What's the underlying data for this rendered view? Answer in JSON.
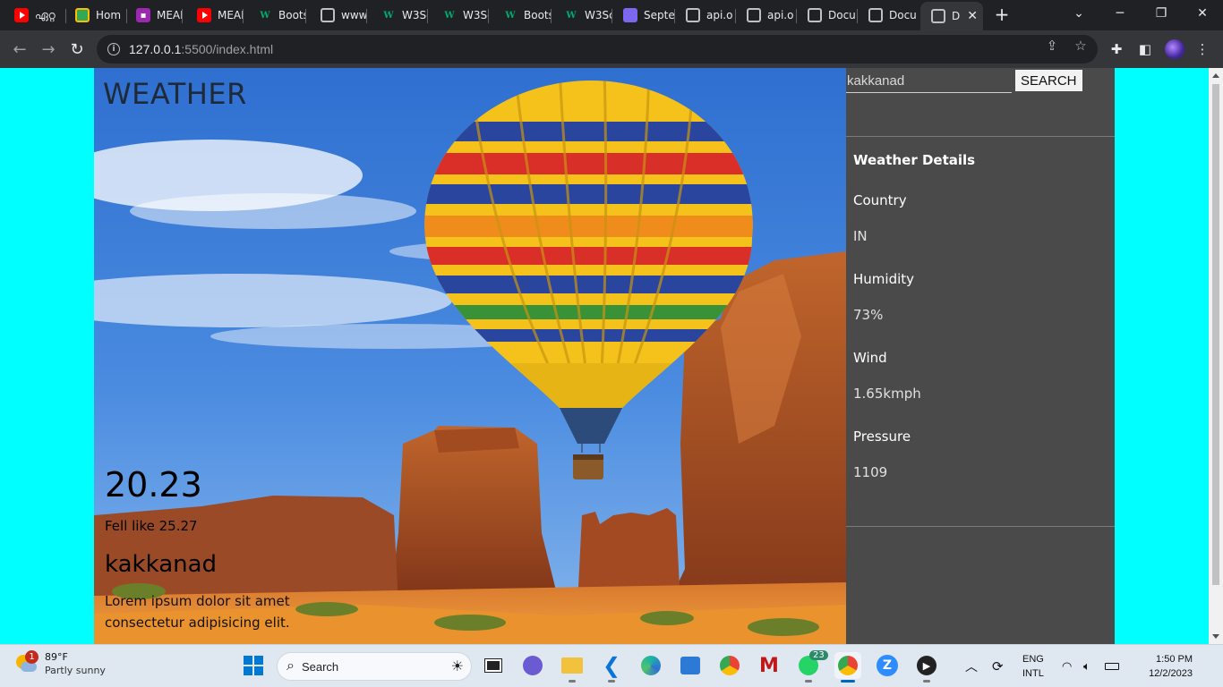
{
  "browser": {
    "tabs": [
      {
        "title": "ഏറ്റ",
        "icon": "youtube-icon"
      },
      {
        "title": "Hom",
        "icon": "classroom-icon"
      },
      {
        "title": "MEAI",
        "icon": "meet-icon"
      },
      {
        "title": "MEAI",
        "icon": "youtube-icon"
      },
      {
        "title": "Boots",
        "icon": "w3schools-icon"
      },
      {
        "title": "www.",
        "icon": "globe-icon"
      },
      {
        "title": "W3Sc",
        "icon": "w3schools-icon"
      },
      {
        "title": "W3Sc",
        "icon": "w3schools-icon"
      },
      {
        "title": "Boots",
        "icon": "w3schools-icon"
      },
      {
        "title": "W3Sc",
        "icon": "w3schools-icon"
      },
      {
        "title": "Septe",
        "icon": "list-icon"
      },
      {
        "title": "api.o",
        "icon": "globe-icon"
      },
      {
        "title": "api.o",
        "icon": "globe-icon"
      },
      {
        "title": "Docu",
        "icon": "globe-icon"
      },
      {
        "title": "Docu",
        "icon": "globe-icon"
      },
      {
        "title": "D",
        "icon": "globe-icon",
        "active": true
      }
    ],
    "url_host": "127.0.0.1",
    "url_path": ":5500/index.html"
  },
  "page": {
    "brand": "WEATHER",
    "temperature": "20.23",
    "feels_like": "Fell like 25.27",
    "city": "kakkanad",
    "description": "Lorem ipsum dolor sit amet consectetur adipisicing elit.",
    "search": {
      "value": "kakkanad",
      "button_label": "SEARCH"
    },
    "details": {
      "title": "Weather Details",
      "country_label": "Country",
      "country_value": "IN",
      "humidity_label": "Humidity",
      "humidity_value": "73%",
      "wind_label": "Wind",
      "wind_value": "1.65kmph",
      "pressure_label": "Pressure",
      "pressure_value": "1109"
    }
  },
  "taskbar": {
    "weather_temp": "89°F",
    "weather_desc": "Partly sunny",
    "weather_badge": "1",
    "search_label": "Search",
    "whatsapp_badge": "23",
    "lang_line1": "ENG",
    "lang_line2": "INTL",
    "time": "1:50 PM",
    "date": "12/2/2023"
  },
  "colors": {
    "page_background": "#00ffff",
    "panel_background": "#4a4a4a",
    "browser_frame": "#202124"
  }
}
